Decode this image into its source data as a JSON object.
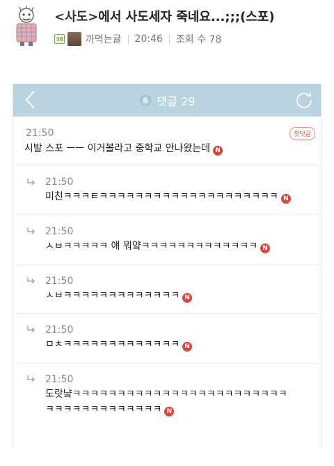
{
  "post": {
    "title_tag": "<사도>",
    "title_rest": "에서 사도세자 죽네요...;;;(스포)",
    "level": "38",
    "author": "까먹는귤",
    "time": "20:46",
    "views": "조회 수 78"
  },
  "comments_header": {
    "label": "댓글 29"
  },
  "first_badge": "첫댓글",
  "new_badge": "N",
  "comments": [
    {
      "time": "21:50",
      "text": "시발 스포 ㅡㅡ 이거볼라고 중학교 안나왔는데"
    },
    {
      "time": "21:50",
      "text": "미친ㅋㅋㅋㅌㅋㅋㅋㅋㅋㅋㅋㅋㅋㅋㅋㅋㅋㅋㅋㅋㅋㅋㅋㅋ"
    },
    {
      "time": "21:50",
      "text": "ㅅㅂㅋㅋㅋㅋㅋ 얘 뭐얔ㅋㅋㅋㅋㅋㅋㅋㅋㅋㅋㅋㅋㅋ"
    },
    {
      "time": "21:50",
      "text": "ㅅㅂㅋㅋㅋㅋㅋㅋㅋㅋㅋㅋㅋㅋㅋ"
    },
    {
      "time": "21:50",
      "text": "ㅁㅊㅋㅋㅋㅋㅋㅋㅋㅋㅋㅋㅋㅋㅋ"
    },
    {
      "time": "21:50",
      "text_line1": "도랏냨ㅋㅋㅋㅋㅋㅋㅋㅋㅋㅋㅋㅋㅋㅋㅋㅋㅋㅋㅋㅋㅋㅋㅋㅋ",
      "text_line2": "ㅋㅋㅋㅋㅋㅋㅋㅋㅋㅋㅋㅋㅋ"
    }
  ],
  "colors": {
    "header_bar": "#b9d3e1",
    "new_badge": "#e0453d",
    "first_badge": "#d9534f"
  },
  "icons": {
    "back": "chevron-left-icon",
    "refresh": "refresh-icon",
    "bell": "bell-icon",
    "reply": "reply-arrow-icon"
  }
}
